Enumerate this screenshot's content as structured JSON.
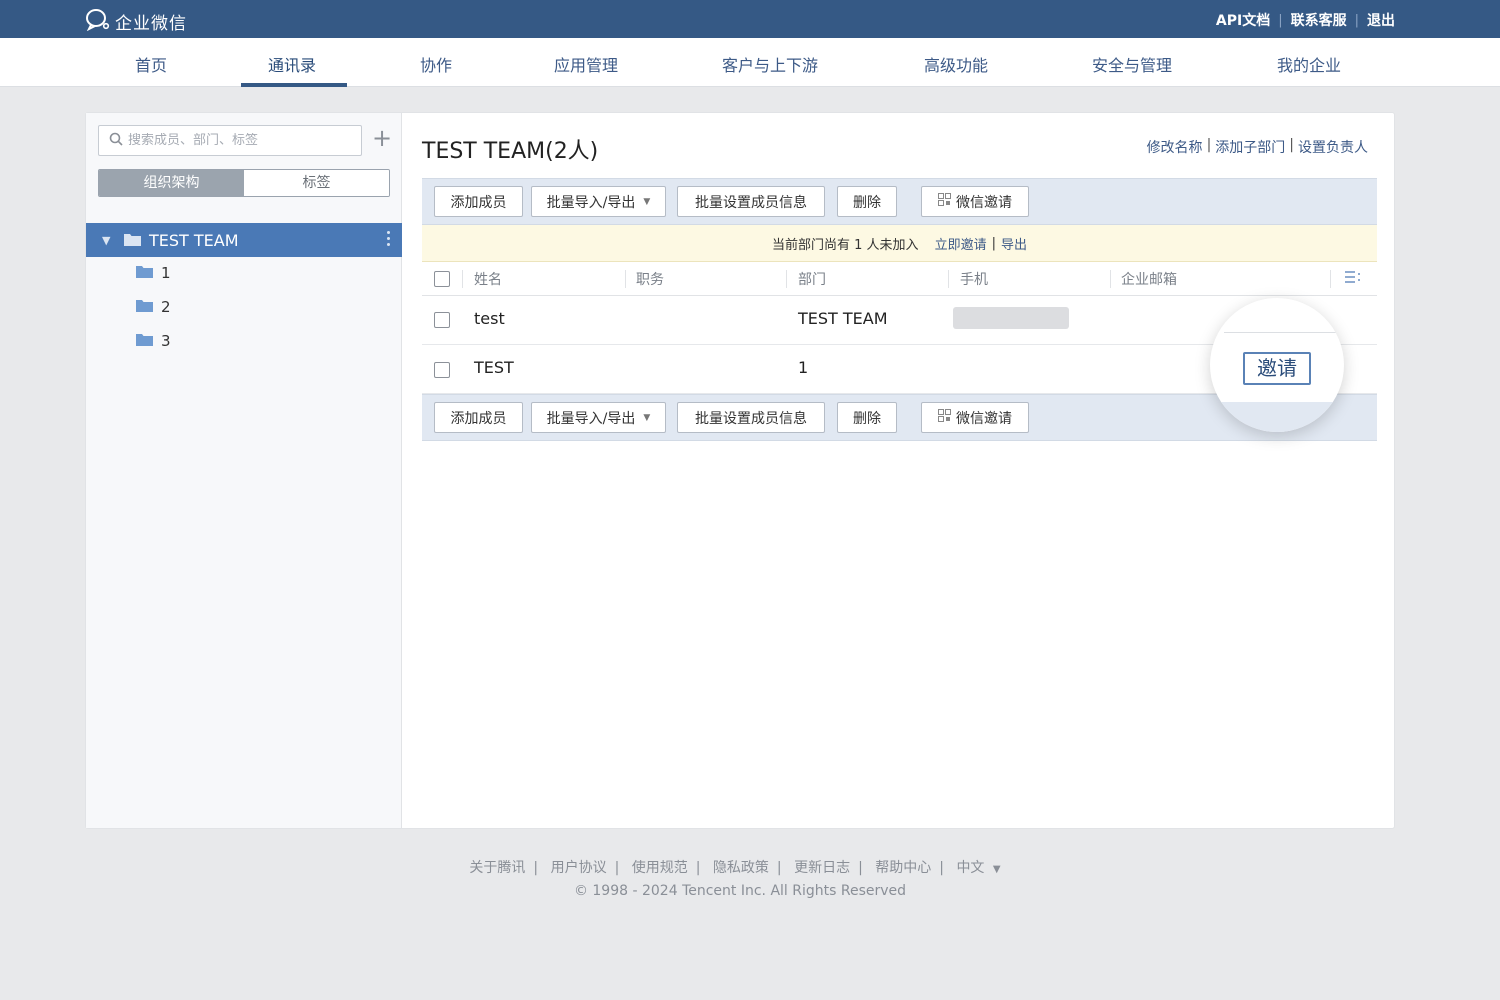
{
  "app": {
    "name": "企业微信"
  },
  "top_links": [
    "API文档",
    "联系客服",
    "退出"
  ],
  "nav": {
    "items": [
      "首页",
      "通讯录",
      "协作",
      "应用管理",
      "客户与上下游",
      "高级功能",
      "安全与管理",
      "我的企业"
    ],
    "active": "通讯录"
  },
  "sidebar": {
    "search_placeholder": "搜索成员、部门、标签",
    "tabs": [
      "组织架构",
      "标签"
    ],
    "active_tab": "组织架构",
    "tree": {
      "root": "TEST TEAM",
      "children": [
        "1",
        "2",
        "3"
      ]
    }
  },
  "main": {
    "title": "TEST TEAM(2人)",
    "title_links": [
      "修改名称",
      "添加子部门",
      "设置负责人"
    ],
    "toolbar": {
      "add_member": "添加成员",
      "batch_import_export": "批量导入/导出",
      "batch_set_info": "批量设置成员信息",
      "delete": "删除",
      "wechat_invite": "微信邀请"
    },
    "notice": {
      "text": "当前部门尚有 1 人未加入",
      "invite_now": "立即邀请",
      "separator": "|",
      "export": "导出"
    },
    "table": {
      "columns": [
        "姓名",
        "职务",
        "部门",
        "手机",
        "企业邮箱"
      ],
      "rows": [
        {
          "name": "test",
          "position": "",
          "department": "TEST TEAM",
          "phone": "",
          "email": ""
        },
        {
          "name": "TEST",
          "position": "",
          "department": "1",
          "phone": "",
          "email": ""
        }
      ]
    },
    "invite_button": "邀请"
  },
  "footer": {
    "links": [
      "关于腾讯",
      "用户协议",
      "使用规范",
      "隐私政策",
      "更新日志",
      "帮助中心",
      "中文"
    ],
    "copyright": "© 1998 - 2024 Tencent Inc. All Rights Reserved"
  },
  "colors": {
    "header_bg": "#355985",
    "accent": "#4a79b6",
    "toolbar_bg": "#e1e8f2",
    "notice_bg": "#fdf9e3"
  }
}
